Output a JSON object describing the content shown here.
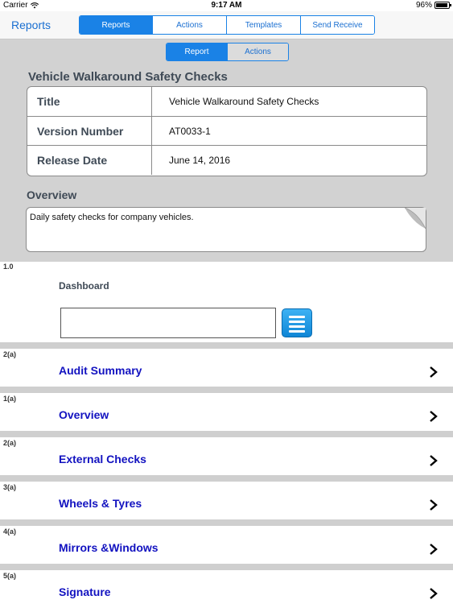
{
  "status_bar": {
    "carrier": "Carrier",
    "time": "9:17 AM",
    "battery": "96%",
    "battery_level": 0.96
  },
  "nav": {
    "back_label": "Reports",
    "tabs": [
      {
        "label": "Reports",
        "active": true
      },
      {
        "label": "Actions",
        "active": false
      },
      {
        "label": "Templates",
        "active": false
      },
      {
        "label": "Send Receive",
        "active": false
      }
    ]
  },
  "sub_tabs": [
    {
      "label": "Report",
      "active": true
    },
    {
      "label": "Actions",
      "active": false
    }
  ],
  "report": {
    "heading": "Vehicle Walkaround Safety Checks",
    "fields": [
      {
        "label": "Title",
        "value": "Vehicle Walkaround Safety Checks"
      },
      {
        "label": "Version Number",
        "value": "AT0033-1"
      },
      {
        "label": "Release Date",
        "value": "June 14, 2016"
      }
    ],
    "overview_label": "Overview",
    "overview_text": "Daily safety checks for company vehicles."
  },
  "dashboard": {
    "number": "1.0",
    "label": "Dashboard",
    "input_value": ""
  },
  "sections": [
    {
      "number": "2(a)",
      "title": "Audit Summary"
    },
    {
      "number": "1(a)",
      "title": "Overview"
    },
    {
      "number": "2(a)",
      "title": "External Checks"
    },
    {
      "number": "3(a)",
      "title": "Wheels & Tyres"
    },
    {
      "number": "4(a)",
      "title": "Mirrors &Windows"
    },
    {
      "number": "5(a)",
      "title": "Signature"
    }
  ],
  "colors": {
    "accent": "#1a82e6",
    "section_title": "#1212c0",
    "grey_bg": "#d2d2d2"
  }
}
